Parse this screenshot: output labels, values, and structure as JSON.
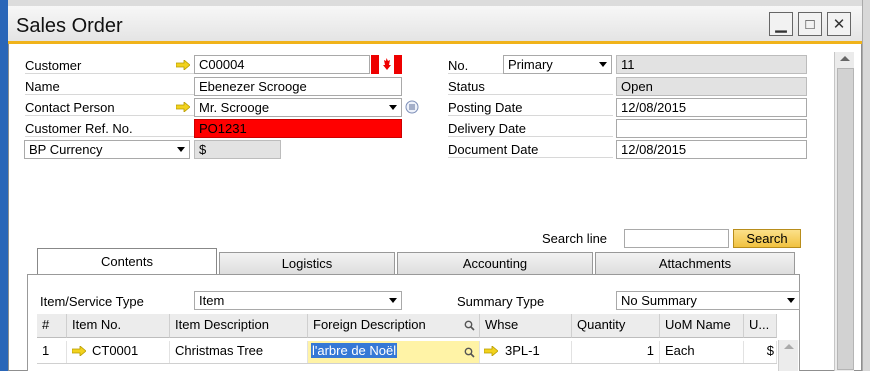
{
  "window": {
    "title": "Sales Order"
  },
  "header_left": {
    "customer_label": "Customer",
    "customer_value": "C00004",
    "name_label": "Name",
    "name_value": "Ebenezer Scrooge",
    "contact_label": "Contact Person",
    "contact_value": "Mr. Scrooge",
    "custref_label": "Customer Ref. No.",
    "custref_value": "PO1231",
    "currency_select": "BP Currency",
    "currency_value": "$"
  },
  "header_right": {
    "no_label": "No.",
    "series_value": "Primary",
    "no_value": "11",
    "status_label": "Status",
    "status_value": "Open",
    "posting_label": "Posting Date",
    "posting_value": "12/08/2015",
    "delivery_label": "Delivery Date",
    "delivery_value": "",
    "docdate_label": "Document Date",
    "docdate_value": "12/08/2015"
  },
  "search": {
    "label": "Search line",
    "value": "",
    "button": "Search"
  },
  "tabs": [
    {
      "label": "Contents"
    },
    {
      "label": "Logistics"
    },
    {
      "label": "Accounting"
    },
    {
      "label": "Attachments"
    }
  ],
  "contents": {
    "item_type_label": "Item/Service Type",
    "item_type_value": "Item",
    "summary_label": "Summary Type",
    "summary_value": "No Summary"
  },
  "table": {
    "columns": [
      "#",
      "Item No.",
      "Item Description",
      "Foreign Description",
      "Whse",
      "Quantity",
      "UoM Name",
      "U..."
    ],
    "rows": [
      {
        "num": "1",
        "item_no": "CT0001",
        "description": "Christmas Tree",
        "foreign": "l'arbre de Noël",
        "whse": "3PL-1",
        "quantity": "1",
        "uom": "Each",
        "u": "$"
      }
    ]
  },
  "colors": {
    "accent": "#f0b31a",
    "required": "#ff0000",
    "link_arrow": "#f2d21e"
  },
  "icons": [
    "link-arrow-icon",
    "canada-flag-icon",
    "dropdown-arrow-icon",
    "list-icon",
    "magnifier-icon",
    "minimize-icon",
    "maximize-icon",
    "close-icon"
  ]
}
